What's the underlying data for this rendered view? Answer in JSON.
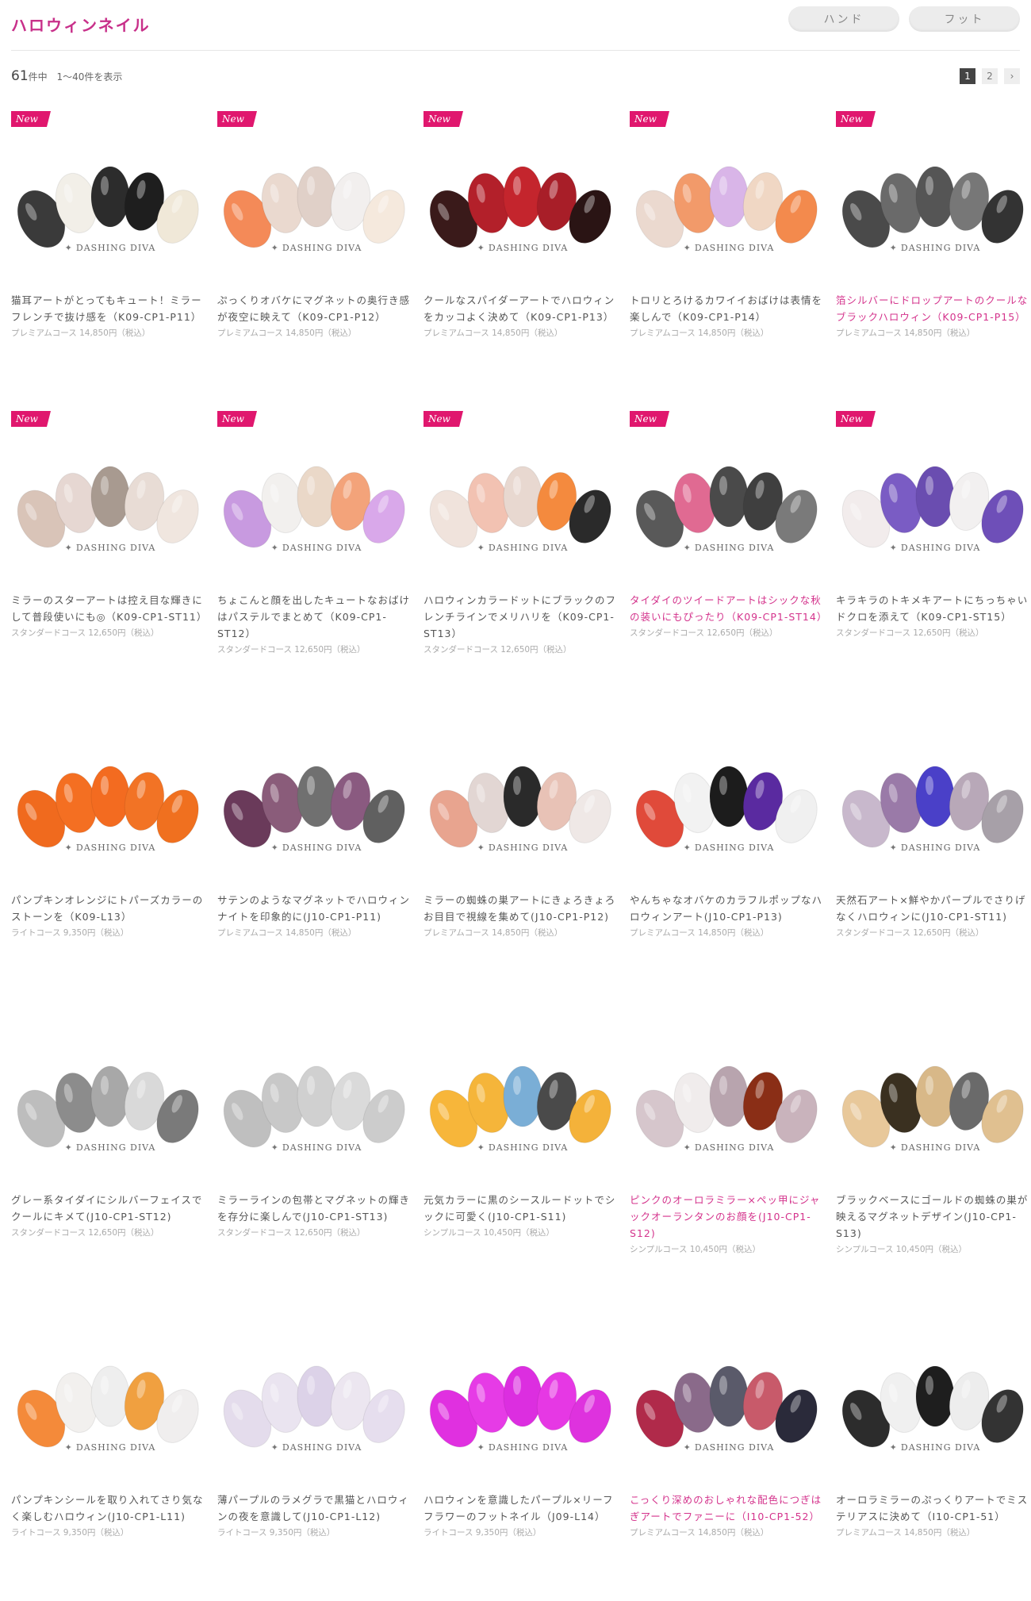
{
  "page_title": "ハロウィンネイル",
  "tabs": [
    "ハンド",
    "フット"
  ],
  "results": {
    "total": "61",
    "unit": "件中",
    "range": "1〜40件を表示"
  },
  "pagination": [
    "1",
    "2",
    "›"
  ],
  "brand": "DASHING DIVA",
  "new_label": "New",
  "products": [
    {
      "new": true,
      "desc": "猫耳アートがとってもキュート！ミラーフレンチで抜け感を（K09-CP1-P11）",
      "price": "プレミアムコース 14,850円（税込）",
      "pink": false,
      "colors": [
        "#3a3a3a",
        "#f2efe8",
        "#2c2c2c",
        "#1e1e1e",
        "#f0e8d8"
      ]
    },
    {
      "new": true,
      "desc": "ぷっくりオバケにマグネットの奥行き感が夜空に映えて（K09-CP1-P12）",
      "price": "プレミアムコース 14,850円（税込）",
      "pink": false,
      "colors": [
        "#f48a58",
        "#ead9cf",
        "#e0d0c8",
        "#f2efee",
        "#f5e9dd"
      ]
    },
    {
      "new": true,
      "desc": "クールなスパイダーアートでハロウィンをカッコよく決めて（K09-CP1-P13）",
      "price": "プレミアムコース 14,850円（税込）",
      "pink": false,
      "colors": [
        "#3a1a1a",
        "#b3202a",
        "#c4252d",
        "#a81e28",
        "#2a1414"
      ]
    },
    {
      "new": true,
      "desc": "トロリとろけるカワイイおばけは表情を楽しんで（K09-CP1-P14）",
      "price": "プレミアムコース 14,850円（税込）",
      "pink": false,
      "colors": [
        "#ebd9cf",
        "#f29a6a",
        "#d9b5e8",
        "#f0d7c4",
        "#f38a4d"
      ]
    },
    {
      "new": true,
      "desc": "箔シルバーにドロップアートのクールなブラックハロウィン（K09-CP1-P15）",
      "price": "プレミアムコース 14,850円（税込）",
      "pink": true,
      "colors": [
        "#4a4a4a",
        "#6a6a6a",
        "#555555",
        "#777777",
        "#333333"
      ]
    },
    {
      "new": true,
      "desc": "ミラーのスターアートは控え目な輝きにして普段使いにも◎（K09-CP1-ST11）",
      "price": "スタンダードコース 12,650円（税込）",
      "pink": false,
      "colors": [
        "#d9c4b8",
        "#e6d7d2",
        "#a89a90",
        "#e8dcd5",
        "#f0e6df"
      ]
    },
    {
      "new": true,
      "desc": "ちょこんと顔を出したキュートなおばけはパステルでまとめて（K09-CP1-ST12）",
      "price": "スタンダードコース 12,650円（税込）",
      "pink": false,
      "colors": [
        "#c89ae0",
        "#f2f0ee",
        "#ead8c8",
        "#f3a37a",
        "#d9a8ea"
      ]
    },
    {
      "new": true,
      "desc": "ハロウィンカラードットにブラックのフレンチラインでメリハリを（K09-CP1-ST13）",
      "price": "スタンダードコース 12,650円（税込）",
      "pink": false,
      "colors": [
        "#f0e3dc",
        "#f2c2b2",
        "#e8d8d0",
        "#f48a3e",
        "#2a2a2a"
      ]
    },
    {
      "new": true,
      "desc": "タイダイのツイードアートはシックな秋の装いにもぴったり（K09-CP1-ST14）",
      "price": "スタンダードコース 12,650円（税込）",
      "pink": true,
      "colors": [
        "#595959",
        "#e06a92",
        "#4a4a4a",
        "#3f3f3f",
        "#7a7a7a"
      ]
    },
    {
      "new": true,
      "desc": "キラキラのトキメキアートにちっちゃいドクロを添えて（K09-CP1-ST15）",
      "price": "スタンダードコース 12,650円（税込）",
      "pink": false,
      "colors": [
        "#f2ecec",
        "#7a5cc4",
        "#6a4db0",
        "#f2f0f0",
        "#6e4fb8"
      ]
    },
    {
      "new": false,
      "desc": "パンプキンオレンジにトパーズカラーのストーンを（K09-L13）",
      "price": "ライトコース 9,350円（税込）",
      "pink": false,
      "colors": [
        "#f06a1e",
        "#f46f22",
        "#f36b20",
        "#f27325",
        "#f0701f"
      ]
    },
    {
      "new": false,
      "desc": "サテンのようなマグネットでハロウィンナイトを印象的に(J10-CP1-P11)",
      "price": "プレミアムコース 14,850円（税込）",
      "pink": false,
      "colors": [
        "#6a3a5a",
        "#8a5c7a",
        "#707070",
        "#8a5a80",
        "#606060"
      ]
    },
    {
      "new": false,
      "desc": "ミラーの蜘蛛の巣アートにきょろきょろお目目で視線を集めて(J10-CP1-P12)",
      "price": "プレミアムコース 14,850円（税込）",
      "pink": false,
      "colors": [
        "#e8a48f",
        "#e2d6d3",
        "#2a2a2a",
        "#e8c2b6",
        "#efe8e6"
      ]
    },
    {
      "new": false,
      "desc": "やんちゃなオバケのカラフルポップなハロウィンアート(J10-CP1-P13)",
      "price": "プレミアムコース 14,850円（税込）",
      "pink": false,
      "colors": [
        "#e04a3a",
        "#f2f2f2",
        "#1c1c1c",
        "#5a2aa0",
        "#f0f0f0"
      ]
    },
    {
      "new": false,
      "desc": "天然石アート×鮮やかパープルでさりげなくハロウィンに(J10-CP1-ST11)",
      "price": "スタンダードコース 12,650円（税込）",
      "pink": false,
      "colors": [
        "#c8b8cc",
        "#9a7aa8",
        "#4a40c8",
        "#b8a8b8",
        "#a7a0a8"
      ]
    },
    {
      "new": false,
      "desc": "グレー系タイダイにシルバーフェイスでクールにキメて(J10-CP1-ST12)",
      "price": "スタンダードコース 12,650円（税込）",
      "pink": false,
      "colors": [
        "#bdbdbd",
        "#8c8c8c",
        "#a8a8a8",
        "#d9d9d9",
        "#7a7a7a"
      ]
    },
    {
      "new": false,
      "desc": "ミラーラインの包帯とマグネットの輝きを存分に楽しんで(J10-CP1-ST13)",
      "price": "スタンダードコース 12,650円（税込）",
      "pink": false,
      "colors": [
        "#bfbfbf",
        "#c8c8c8",
        "#d0d0d0",
        "#dadada",
        "#cccccc"
      ]
    },
    {
      "new": false,
      "desc": "元気カラーに黒のシースルードットでシックに可愛く(J10-CP1-S11)",
      "price": "シンプルコース 10,450円（税込）",
      "pink": false,
      "colors": [
        "#f7b63a",
        "#f5b53a",
        "#7aaed6",
        "#4a4a4a",
        "#f4b23a"
      ]
    },
    {
      "new": false,
      "desc": "ピンクのオーロラミラー×ペッ甲にジャックオーランタンのお顔を(J10-CP1-S12)",
      "price": "シンプルコース 10,450円（税込）",
      "pink": true,
      "colors": [
        "#d6c6cc",
        "#f0ecec",
        "#b8a4ae",
        "#8a2e16",
        "#c9b3bc"
      ]
    },
    {
      "new": false,
      "desc": "ブラックベースにゴールドの蜘蛛の巣が映えるマグネットデザイン(J10-CP1-S13)",
      "price": "シンプルコース 10,450円（税込）",
      "pink": false,
      "colors": [
        "#e8c89a",
        "#3a3020",
        "#d8b888",
        "#6a6a6a",
        "#e0c090"
      ]
    },
    {
      "new": false,
      "desc": "パンプキンシールを取り入れてさり気なく楽しむハロウィン(J10-CP1-L11)",
      "price": "ライトコース 9,350円（税込）",
      "pink": false,
      "colors": [
        "#f48a3a",
        "#f2f0ee",
        "#eeeeee",
        "#f0a040",
        "#f0eeee"
      ]
    },
    {
      "new": false,
      "desc": "薄パープルのラメグラで黒猫とハロウィンの夜を意識して(J10-CP1-L12)",
      "price": "ライトコース 9,350円（税込）",
      "pink": false,
      "colors": [
        "#e4dcec",
        "#eae4f0",
        "#dcd2e8",
        "#ece6f0",
        "#e6deee"
      ]
    },
    {
      "new": false,
      "desc": "ハロウィンを意識したパープル×リーフフラワーのフットネイル（J09-L14）",
      "price": "ライトコース 9,350円（税込）",
      "pink": false,
      "colors": [
        "#e030e0",
        "#e63be6",
        "#dc2ee0",
        "#e638e4",
        "#de32de"
      ]
    },
    {
      "new": false,
      "desc": "こっくり深めのおしゃれな配色につぎはぎアートでファニーに（I10-CP1-52）",
      "price": "プレミアムコース 14,850円（税込）",
      "pink": true,
      "colors": [
        "#b02a4a",
        "#8a6a8a",
        "#5a5a6a",
        "#c85a6a",
        "#2a2a3a"
      ]
    },
    {
      "new": false,
      "desc": "オーロラミラーのぷっくりアートでミステリアスに決めて（I10-CP1-51）",
      "price": "プレミアムコース 14,850円（税込）",
      "pink": false,
      "colors": [
        "#2c2c2c",
        "#f0f0f0",
        "#1e1e1e",
        "#ededed",
        "#333333"
      ]
    }
  ]
}
